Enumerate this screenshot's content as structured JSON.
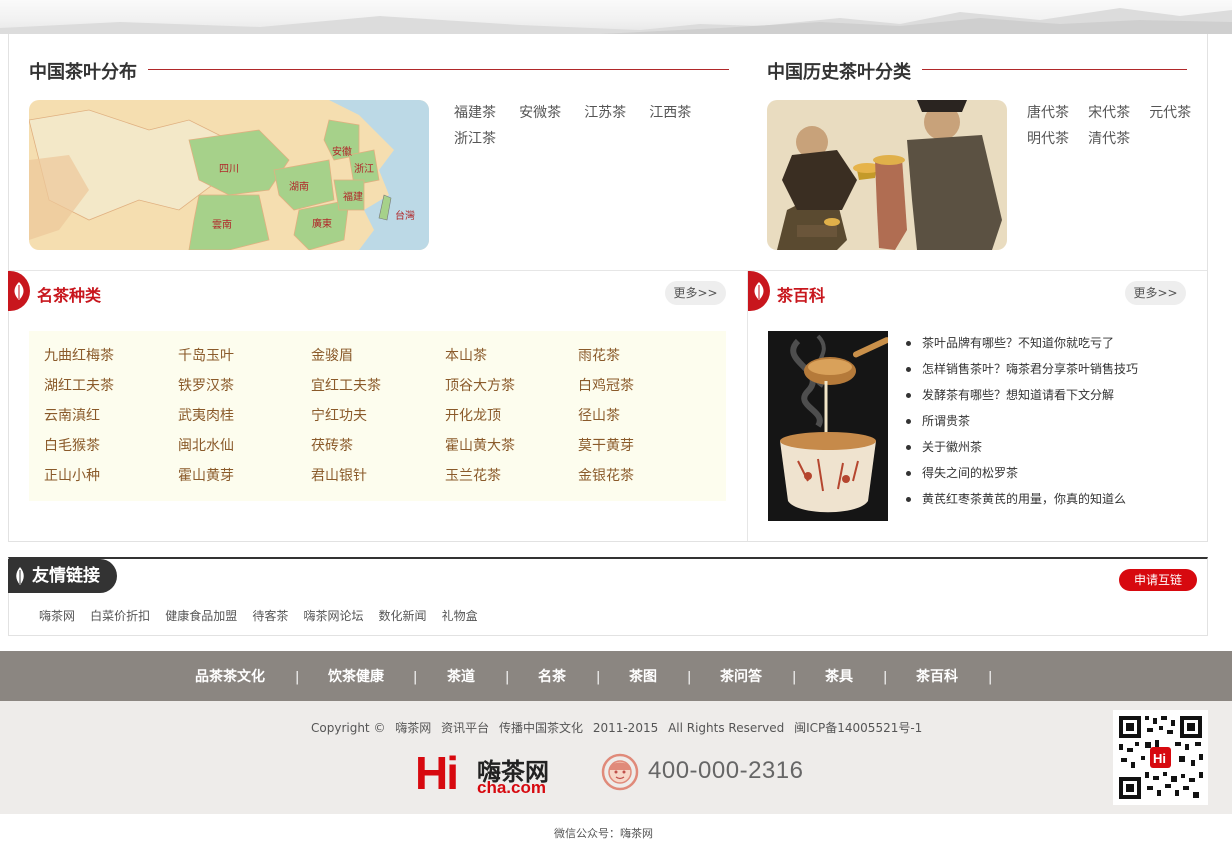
{
  "distribution": {
    "title": "中国茶叶分布",
    "links": [
      "福建茶",
      "安微茶",
      "江苏茶",
      "江西茶",
      "浙江茶"
    ],
    "map_labels": [
      "四川",
      "安徽",
      "浙江",
      "湖南",
      "福建",
      "雲南",
      "廣東",
      "台灣"
    ]
  },
  "history": {
    "title": "中国历史茶叶分类",
    "links": [
      "唐代茶",
      "宋代茶",
      "元代茶",
      "明代茶",
      "清代茶"
    ]
  },
  "famous": {
    "title": "名茶种类",
    "more": "更多>>",
    "items": [
      "九曲红梅茶",
      "千岛玉叶",
      "金骏眉",
      "本山茶",
      "雨花茶",
      "湖红工夫茶",
      "铁罗汉茶",
      "宜红工夫茶",
      "顶谷大方茶",
      "白鸡冠茶",
      "云南滇红",
      "武夷肉桂",
      "宁红功夫",
      "开化龙顶",
      "径山茶",
      "白毛猴茶",
      "闽北水仙",
      "茯砖茶",
      "霍山黄大茶",
      "莫干黄芽",
      "正山小种",
      "霍山黄芽",
      "君山银针",
      "玉兰花茶",
      "金银花茶"
    ]
  },
  "wiki": {
    "title": "茶百科",
    "more": "更多>>",
    "items": [
      "茶叶品牌有哪些？不知道你就吃亏了",
      "怎样销售茶叶？嗨茶君分享茶叶销售技巧",
      "发酵茶有哪些？想知道请看下文分解",
      "所谓贵茶",
      "关于徽州茶",
      "得失之间的松罗茶",
      "黄芪红枣茶黄芪的用量，你真的知道么"
    ]
  },
  "friends": {
    "title": "友情链接",
    "apply": "申请互链",
    "links": [
      "嗨茶网",
      "白菜价折扣",
      "健康食品加盟",
      "待客茶",
      "嗨茶网论坛",
      "数化新闻",
      "礼物盒"
    ]
  },
  "footer": {
    "nav": [
      "品茶茶文化",
      "饮茶健康",
      "茶道",
      "名茶",
      "茶图",
      "茶问答",
      "茶具",
      "茶百科"
    ],
    "separator": "|",
    "copyright": [
      "Copyright ©",
      "嗨茶网",
      "资讯平台",
      "传播中国茶文化",
      "2011-2015",
      "All Rights Reserved",
      "闽ICP备14005521号-1"
    ],
    "logo_hi": "Hi",
    "logo_cn": "嗨茶网",
    "logo_domain": "cha.com",
    "phone": "400-000-2316",
    "wechat": "微信公众号：嗨茶网"
  },
  "colors": {
    "accent": "#c8161d",
    "nav_bg": "#8b8681",
    "footer_bg": "#eeecea",
    "grid_bg": "#fdfdee"
  }
}
